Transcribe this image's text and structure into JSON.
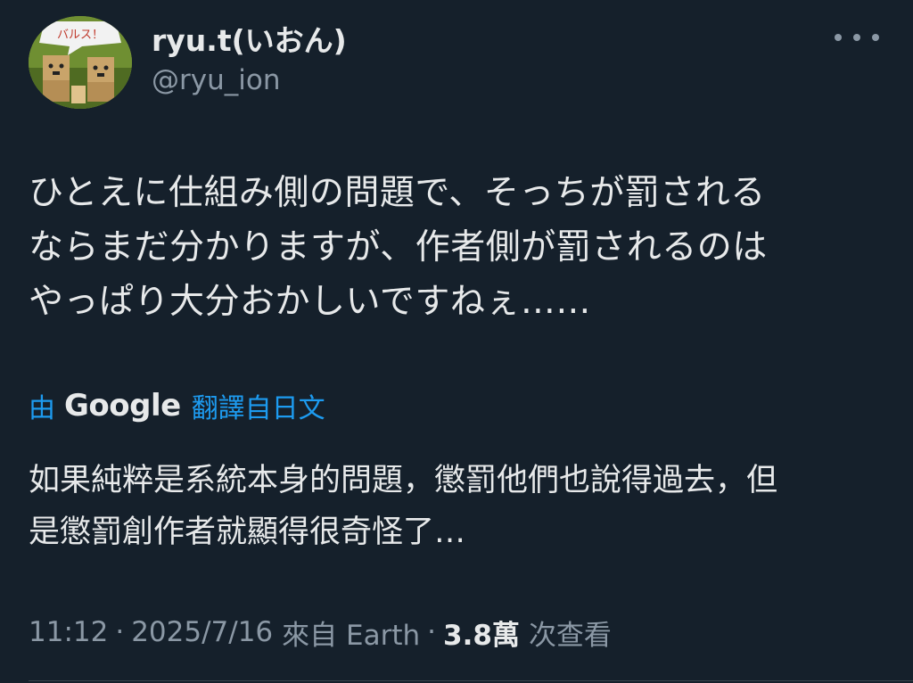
{
  "user": {
    "display_name": "ryu.t(いおん)",
    "handle": "@ryu_ion",
    "avatar_caption": "バルス！"
  },
  "post": {
    "text": "ひとえに仕組み側の問題で、そっちが罰される\nならまだ分かりますが、作者側が罰されるのは\nやっぱり大分おかしいですねぇ……"
  },
  "translation": {
    "prefix": "由",
    "brand": "Google",
    "suffix": "翻譯自日文",
    "text": "如果純粹是系統本身的問題，懲罰他們也說得過去，但\n是懲罰創作者就顯得很奇怪了…"
  },
  "meta": {
    "time": "11:12",
    "date": "2025/7/16",
    "source": "來自 Earth",
    "separator": "·",
    "views_count": "3.8萬",
    "views_label": "次查看"
  },
  "colors": {
    "background": "#15202b",
    "primary_text": "#e7e9ea",
    "secondary_text": "#8b98a5",
    "accent": "#1d9bf0"
  },
  "icons": {
    "more": "more-horizontal-icon"
  }
}
